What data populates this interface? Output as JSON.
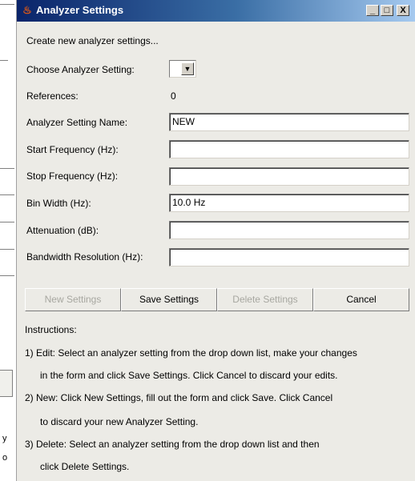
{
  "background": {
    "side_chars": [
      "y",
      "o"
    ]
  },
  "window": {
    "title": "Analyzer Settings",
    "app_icon": "java-coffee-icon",
    "controls": {
      "minimize": "_",
      "maximize": "□",
      "close": "X"
    }
  },
  "form": {
    "heading": "Create new analyzer settings...",
    "choose_label": "Choose Analyzer Setting:",
    "choose_value": "",
    "references_label": "References:",
    "references_value": "0",
    "name_label": "Analyzer Setting Name:",
    "name_value": "NEW",
    "start_label": "Start Frequency (Hz):",
    "start_value": "",
    "stop_label": "Stop Frequency (Hz):",
    "stop_value": "",
    "bin_label": "Bin Width (Hz):",
    "bin_value": "10.0 Hz",
    "atten_label": "Attenuation (dB):",
    "atten_value": "",
    "bw_label": "Bandwidth Resolution (Hz):",
    "bw_value": ""
  },
  "buttons": {
    "new": "New Settings",
    "save": "Save Settings",
    "delete": "Delete Settings",
    "cancel": "Cancel"
  },
  "instructions": {
    "title": "Instructions:",
    "lines": [
      "1) Edit: Select an analyzer setting from the drop down list, make your changes",
      "in the form and click Save Settings.  Click Cancel to discard your edits.",
      "2) New: Click New Settings, fill out the form and click Save.  Click Cancel",
      "to discard your new Analyzer Setting.",
      "3) Delete: Select an analyzer setting from the drop down list and then",
      "click Delete Settings."
    ]
  }
}
